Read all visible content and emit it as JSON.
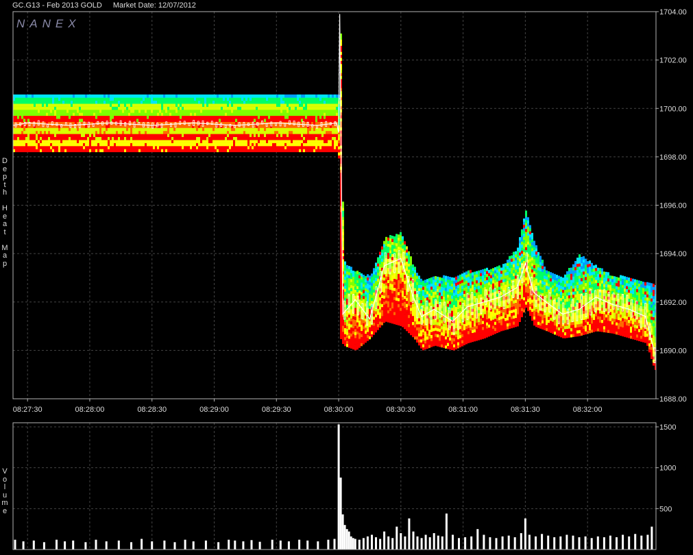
{
  "header": {
    "symbol": "GC.G13 - Feb 2013 GOLD",
    "market_date": "Market Date: 12/07/2012"
  },
  "watermark": "NANEX",
  "side_labels": {
    "heatmap": "Depth Heat Map",
    "volume": "Volume"
  },
  "colors": {
    "background": "#000000",
    "frame": "#b4b4b4",
    "grid": "#444444",
    "price_line": "#ffffff",
    "heat_levels": [
      "#ff0000",
      "#ff6a00",
      "#ffff00",
      "#d8ff00",
      "#7fff00",
      "#00ff66",
      "#00e5ff",
      "#00a0ff"
    ],
    "volume_bar": "#ffffff"
  },
  "chart_data": [
    {
      "type": "heatmap",
      "name": "depth-heat-map",
      "x_ticks": [
        "08:27:30",
        "08:28:00",
        "08:28:30",
        "08:29:00",
        "08:29:30",
        "08:30:00",
        "08:30:30",
        "08:31:00",
        "08:31:30",
        "08:32:00"
      ],
      "x_tick_seconds": [
        0,
        30,
        60,
        90,
        120,
        150,
        180,
        210,
        240,
        270
      ],
      "xlim_seconds": [
        -7,
        303
      ],
      "y_ticks": [
        "1704.00",
        "1702.00",
        "1700.00",
        "1698.00",
        "1696.00",
        "1694.00",
        "1692.00",
        "1690.00",
        "1688.00"
      ],
      "y_tick_values": [
        1704,
        1702,
        1700,
        1698,
        1696,
        1694,
        1692,
        1690,
        1688
      ],
      "ylim": [
        1688,
        1704
      ],
      "grid": true,
      "price_series": {
        "t": [
          -7,
          0,
          20,
          40,
          60,
          80,
          100,
          120,
          140,
          149,
          150,
          150.5,
          152,
          158,
          165,
          172,
          180,
          186,
          190,
          196,
          205,
          212,
          220,
          228,
          236,
          240,
          244,
          250,
          258,
          266,
          274,
          282,
          290,
          298,
          302
        ],
        "price": [
          1699.3,
          1699.4,
          1699.3,
          1699.4,
          1699.3,
          1699.4,
          1699.3,
          1699.4,
          1699.3,
          1699.4,
          1699.0,
          1703.9,
          1691.5,
          1692.1,
          1691.3,
          1693.5,
          1693.8,
          1692.2,
          1691.4,
          1691.7,
          1691.2,
          1691.8,
          1692.0,
          1692.2,
          1692.6,
          1693.6,
          1692.4,
          1692.0,
          1691.5,
          1691.7,
          1692.2,
          1691.9,
          1691.7,
          1691.4,
          1690.0
        ]
      },
      "depth_envelope": {
        "t": [
          -7,
          149,
          150,
          150.5,
          152,
          158,
          165,
          172,
          180,
          186,
          190,
          196,
          205,
          212,
          220,
          228,
          236,
          240,
          244,
          250,
          258,
          266,
          274,
          282,
          290,
          298,
          302
        ],
        "upper": [
          1700.5,
          1700.5,
          1700.5,
          1704.0,
          1693.6,
          1693.2,
          1693.0,
          1694.6,
          1694.8,
          1693.4,
          1692.8,
          1693.0,
          1693.0,
          1693.2,
          1693.3,
          1693.4,
          1694.2,
          1695.8,
          1694.4,
          1693.2,
          1693.0,
          1693.9,
          1693.4,
          1693.0,
          1693.0,
          1692.8,
          1692.6
        ],
        "lower": [
          1698.2,
          1698.2,
          1697.8,
          1690.5,
          1690.2,
          1690.0,
          1690.5,
          1691.2,
          1691.0,
          1690.5,
          1690.0,
          1690.2,
          1690.0,
          1690.3,
          1690.5,
          1690.8,
          1691.0,
          1691.8,
          1691.0,
          1690.8,
          1690.5,
          1690.6,
          1690.8,
          1690.7,
          1690.5,
          1690.3,
          1689.2
        ]
      }
    },
    {
      "type": "bar",
      "name": "volume",
      "y_ticks": [
        "1500",
        "1000",
        "500"
      ],
      "y_tick_values": [
        1500,
        1000,
        500
      ],
      "ylim": [
        0,
        1550
      ],
      "grid": true,
      "x_seconds": [
        -6,
        -2,
        3,
        8,
        14,
        18,
        22,
        28,
        33,
        38,
        44,
        50,
        55,
        60,
        66,
        71,
        76,
        80,
        86,
        92,
        97,
        100,
        104,
        108,
        112,
        118,
        122,
        126,
        131,
        135,
        140,
        145,
        148,
        150,
        151,
        152,
        153,
        154,
        155,
        156,
        157,
        158,
        160,
        162,
        164,
        166,
        168,
        170,
        172,
        174,
        176,
        178,
        180,
        182,
        184,
        186,
        188,
        190,
        192,
        194,
        196,
        198,
        200,
        202,
        205,
        208,
        211,
        214,
        217,
        220,
        223,
        226,
        229,
        232,
        235,
        238,
        240,
        242,
        245,
        248,
        251,
        254,
        257,
        260,
        263,
        266,
        269,
        272,
        275,
        278,
        281,
        284,
        287,
        290,
        293,
        296,
        299,
        301
      ],
      "values": [
        120,
        100,
        110,
        90,
        120,
        100,
        110,
        90,
        120,
        100,
        110,
        90,
        130,
        100,
        110,
        90,
        120,
        100,
        110,
        90,
        120,
        110,
        100,
        115,
        95,
        120,
        110,
        100,
        120,
        110,
        100,
        120,
        130,
        1530,
        880,
        430,
        300,
        250,
        220,
        160,
        140,
        130,
        120,
        140,
        160,
        180,
        150,
        130,
        220,
        160,
        140,
        280,
        200,
        160,
        380,
        220,
        160,
        140,
        180,
        150,
        200,
        170,
        160,
        440,
        180,
        140,
        150,
        160,
        250,
        180,
        150,
        140,
        160,
        170,
        150,
        200,
        380,
        180,
        160,
        190,
        170,
        150,
        160,
        180,
        170,
        150,
        160,
        140,
        160,
        150,
        170,
        150,
        180,
        160,
        190,
        170,
        180,
        280
      ]
    }
  ]
}
